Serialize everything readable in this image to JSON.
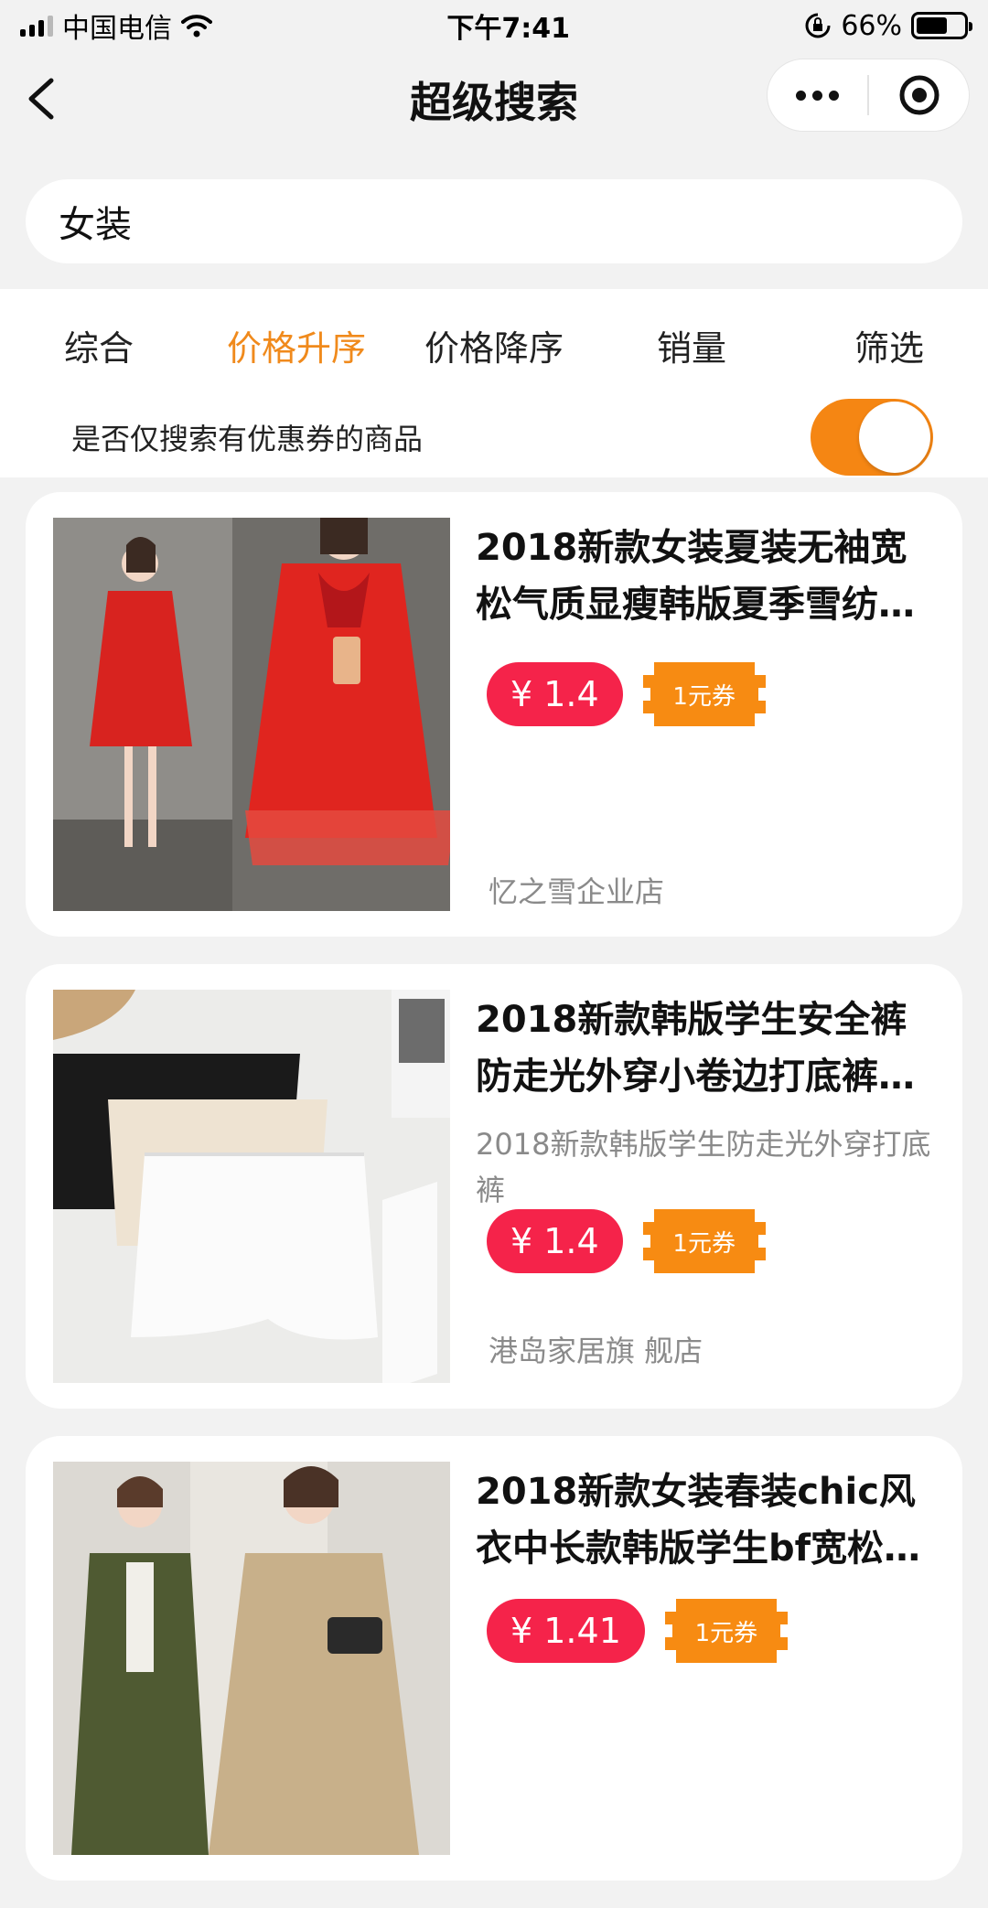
{
  "status_bar": {
    "carrier": "中国电信",
    "time": "下午7:41",
    "battery_percent": "66%",
    "battery_level": 0.66,
    "icons": [
      "signal-icon",
      "wifi-icon",
      "rotation-lock-icon",
      "battery-icon"
    ]
  },
  "header": {
    "title": "超级搜索",
    "back_icon": "chevron-left-icon",
    "more_icon": "more-dots-icon",
    "close_icon": "target-circle-icon"
  },
  "search": {
    "value": "女装"
  },
  "filters": {
    "tabs": [
      {
        "label": "综合",
        "active": false
      },
      {
        "label": "价格升序",
        "active": true
      },
      {
        "label": "价格降序",
        "active": false
      },
      {
        "label": "销量",
        "active": false
      },
      {
        "label": "筛选",
        "active": false
      }
    ],
    "coupon_only_label": "是否仅搜索有优惠券的商品",
    "coupon_only_enabled": true
  },
  "colors": {
    "accent_orange": "#f08a1c",
    "toggle_orange": "#f58613",
    "price_red": "#f5234a",
    "coupon_orange": "#f78b12"
  },
  "products": [
    {
      "title": "2018新款女装夏装无袖宽松气质显瘦韩版夏季雪纺…",
      "description": "",
      "price": "¥ 1.4",
      "coupon": "1元券",
      "shop": "忆之雪企业店",
      "image": "red-dress-photo"
    },
    {
      "title": "2018新款韩版学生安全裤防走光外穿小卷边打底裤…",
      "description": "2018新款韩版学生防走光外穿打底裤",
      "price": "¥ 1.4",
      "coupon": "1元券",
      "shop": "港岛家居旗 舰店",
      "image": "safety-shorts-photo"
    },
    {
      "title": "2018新款女装春装chic风衣中长款韩版学生bf宽松…",
      "description": "",
      "price": "¥ 1.41",
      "coupon": "1元券",
      "shop": "",
      "image": "trench-coat-photo"
    }
  ]
}
